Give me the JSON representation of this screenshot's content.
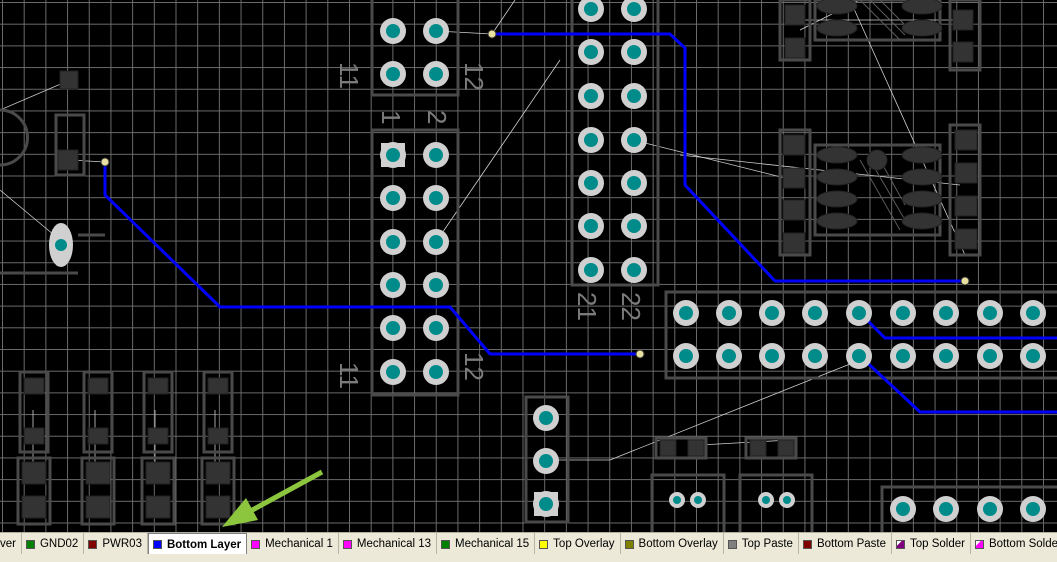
{
  "editor": {
    "layers": [
      {
        "label": "ver",
        "color": "#ece9d8",
        "active": false
      },
      {
        "label": "GND02",
        "color": "#008000",
        "active": false
      },
      {
        "label": "PWR03",
        "color": "#800000",
        "active": false
      },
      {
        "label": "Bottom Layer",
        "color": "#0000ff",
        "active": true
      },
      {
        "label": "Mechanical 1",
        "color": "#ff00ff",
        "active": false
      },
      {
        "label": "Mechanical 13",
        "color": "#ff00ff",
        "active": false
      },
      {
        "label": "Mechanical 15",
        "color": "#008000",
        "active": false
      },
      {
        "label": "Top Overlay",
        "color": "#ffff00",
        "active": false
      },
      {
        "label": "Bottom Overlay",
        "color": "#808000",
        "active": false
      },
      {
        "label": "Top Paste",
        "color": "#808080",
        "active": false
      },
      {
        "label": "Bottom Paste",
        "color": "#800000",
        "active": false
      },
      {
        "label": "Top Solder",
        "color": "#800080",
        "active": false
      },
      {
        "label": "Bottom Solder",
        "color": "#ff00ff",
        "active": false
      }
    ],
    "silkscreen_labels": {
      "header1_pin11": "11",
      "header1_pin12": "12",
      "header2_pin1": "1",
      "header2_pin2": "2",
      "header2_pin11": "11",
      "header2_pin12": "12",
      "header3_pin21": "21",
      "header3_pin22": "22"
    },
    "colors": {
      "grid": "#6b6b6b",
      "pad": "#008b8b",
      "pad_ring": "#d0d0d0",
      "trace_bottom": "#0000ff",
      "outline": "#4a4a4a",
      "arrow": "#8cc63f"
    }
  }
}
